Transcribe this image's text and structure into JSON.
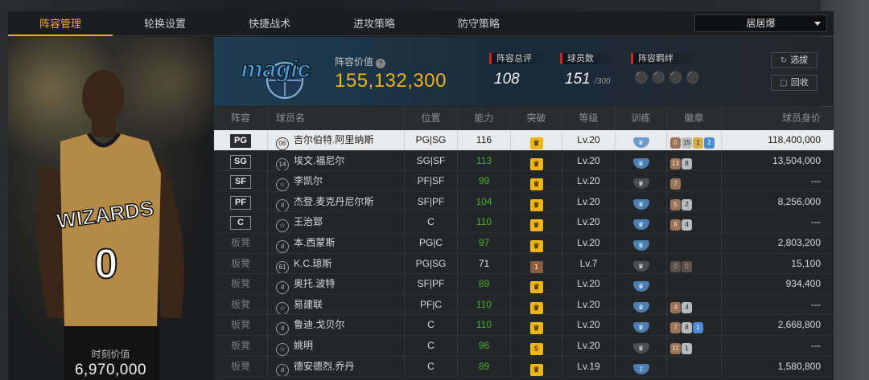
{
  "tabs": [
    "阵容管理",
    "轮换设置",
    "快捷战术",
    "进攻策略",
    "防守策略"
  ],
  "active_tab": 0,
  "team_select": "居居爆",
  "player_card": {
    "worth_label": "时刻价值",
    "worth_value": "6,970,000",
    "jersey_text": "WIZARDS",
    "jersey_number": "0"
  },
  "header": {
    "logo_text": "magic",
    "lineup_value_label": "阵容价值",
    "lineup_value": "155,132,300",
    "overall_label": "阵容总评",
    "overall_value": "108",
    "count_label": "球员数",
    "count_value": "151",
    "count_max": "/300",
    "bonds_label": "阵容羁绊",
    "select_button": "选拔",
    "recycle_button": "回收"
  },
  "columns": [
    "阵容",
    "球员名",
    "位置",
    "能力",
    "突破",
    "等级",
    "训练",
    "徽章",
    "球员身价"
  ],
  "rows": [
    {
      "slot": "PG",
      "starter": true,
      "num": "06",
      "name": "吉尔伯特.阿里纳斯",
      "pos": "PG|SG",
      "ability": "116",
      "ab_color": "white",
      "brk": "",
      "brk_color": "gold",
      "level": "Lv.20",
      "train": "",
      "train_color": "blue",
      "badges": [
        [
          "0",
          "bronze"
        ],
        [
          "15",
          "silver"
        ],
        [
          "1",
          "gold"
        ],
        [
          "2",
          "blue"
        ]
      ],
      "price": "118,400,000",
      "selected": true
    },
    {
      "slot": "SG",
      "starter": true,
      "num": "14",
      "name": "埃文.福尼尔",
      "pos": "SG|SF",
      "ability": "113",
      "ab_color": "green",
      "brk": "",
      "brk_color": "gold",
      "level": "Lv.20",
      "train": "",
      "train_color": "blue",
      "badges": [
        [
          "13",
          "bronze"
        ],
        [
          "8",
          "silver"
        ]
      ],
      "price": "13,504,000"
    },
    {
      "slot": "SF",
      "starter": true,
      "num": "☆",
      "name": "李凯尔",
      "pos": "PF|SF",
      "ability": "99",
      "ab_color": "green",
      "brk": "",
      "brk_color": "gold",
      "level": "Lv.20",
      "train": "",
      "train_color": "gray",
      "badges": [
        [
          "7",
          "bronze"
        ]
      ],
      "price": "---"
    },
    {
      "slot": "PF",
      "starter": true,
      "num": "ıl",
      "name": "杰登.麦克丹尼尔斯",
      "pos": "SF|PF",
      "ability": "104",
      "ab_color": "green",
      "brk": "",
      "brk_color": "gold",
      "level": "Lv.20",
      "train": "",
      "train_color": "blue",
      "badges": [
        [
          "5",
          "bronze"
        ],
        [
          "2",
          "silver"
        ]
      ],
      "price": "8,256,000"
    },
    {
      "slot": "C",
      "starter": true,
      "num": "☆",
      "name": "王治郅",
      "pos": "C",
      "ability": "110",
      "ab_color": "green",
      "brk": "",
      "brk_color": "gold",
      "level": "Lv.20",
      "train": "",
      "train_color": "blue",
      "badges": [
        [
          "8",
          "bronze"
        ],
        [
          "4",
          "silver"
        ]
      ],
      "price": "---"
    },
    {
      "slot": "板凳",
      "starter": false,
      "num": "ıl",
      "name": "本.西蒙斯",
      "pos": "PG|C",
      "ability": "97",
      "ab_color": "green",
      "brk": "",
      "brk_color": "gold",
      "level": "Lv.20",
      "train": "",
      "train_color": "blue",
      "badges": [],
      "price": "2,803,200"
    },
    {
      "slot": "板凳",
      "starter": false,
      "num": "61",
      "name": "K.C.琼斯",
      "pos": "PG|SG",
      "ability": "71",
      "ab_color": "white",
      "brk": "1",
      "brk_color": "brown",
      "level": "Lv.7",
      "train": "",
      "train_color": "gray",
      "badges": [
        [
          "0",
          "dim"
        ],
        [
          "0",
          "dim"
        ]
      ],
      "price": "15,100"
    },
    {
      "slot": "板凳",
      "starter": false,
      "num": "ıl",
      "name": "奥托.波特",
      "pos": "SF|PF",
      "ability": "89",
      "ab_color": "green",
      "brk": "",
      "brk_color": "gold",
      "level": "Lv.20",
      "train": "",
      "train_color": "blue",
      "badges": [],
      "price": "934,400"
    },
    {
      "slot": "板凳",
      "starter": false,
      "num": "☆",
      "name": "易建联",
      "pos": "PF|C",
      "ability": "110",
      "ab_color": "green",
      "brk": "",
      "brk_color": "gold",
      "level": "Lv.20",
      "train": "",
      "train_color": "blue",
      "badges": [
        [
          "4",
          "bronze"
        ],
        [
          "4",
          "silver"
        ]
      ],
      "price": "---"
    },
    {
      "slot": "板凳",
      "starter": false,
      "num": "ıl",
      "name": "鲁迪.戈贝尔",
      "pos": "C",
      "ability": "110",
      "ab_color": "green",
      "brk": "",
      "brk_color": "gold",
      "level": "Lv.20",
      "train": "",
      "train_color": "blue",
      "badges": [
        [
          "7",
          "bronze"
        ],
        [
          "8",
          "silver"
        ],
        [
          "1",
          "blue"
        ]
      ],
      "price": "2,668,800"
    },
    {
      "slot": "板凳",
      "starter": false,
      "num": "☆",
      "name": "姚明",
      "pos": "C",
      "ability": "96",
      "ab_color": "green",
      "brk": "5",
      "brk_color": "gold",
      "level": "Lv.20",
      "train": "",
      "train_color": "gray",
      "badges": [
        [
          "11",
          "bronze"
        ],
        [
          "1",
          "silver"
        ]
      ],
      "price": "---"
    },
    {
      "slot": "板凳",
      "starter": false,
      "num": "ıl",
      "name": "德安德烈.乔丹",
      "pos": "C",
      "ability": "89",
      "ab_color": "green",
      "brk": "",
      "brk_color": "gold",
      "level": "Lv.19",
      "train": "2",
      "train_color": "blue",
      "badges": [],
      "price": "1,580,800"
    }
  ],
  "colors": {
    "accent": "#f1b21d",
    "green": "#4caf2a",
    "starter_red": "#c9252a"
  }
}
